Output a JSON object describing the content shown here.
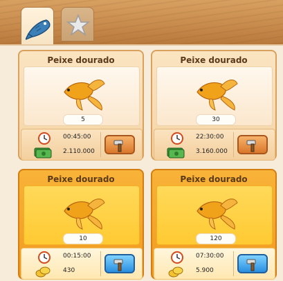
{
  "tabs": [
    {
      "name": "fish",
      "icon": "fish-icon",
      "active": true
    },
    {
      "name": "star",
      "icon": "star-icon",
      "active": false
    }
  ],
  "cards": [
    {
      "title": "Peixe dourado",
      "quantity": "5",
      "time": "00:45:00",
      "price": "2.110.000",
      "currency": "cash-icon",
      "style": "white",
      "button": "hammer-icon"
    },
    {
      "title": "Peixe dourado",
      "quantity": "30",
      "time": "22:30:00",
      "price": "3.160.000",
      "currency": "cash-icon",
      "style": "white",
      "button": "hammer-icon"
    },
    {
      "title": "Peixe dourado",
      "quantity": "10",
      "time": "00:15:00",
      "price": "430",
      "currency": "coins-icon",
      "style": "gold",
      "button": "hammer-icon"
    },
    {
      "title": "Peixe dourado",
      "quantity": "120",
      "time": "07:30:00",
      "price": "5.900",
      "currency": "coins-icon",
      "style": "gold",
      "button": "hammer-icon"
    }
  ],
  "colors": {
    "white_card": "#f5d4a6",
    "gold_card": "#f19a1f",
    "orange_button": "#d9772c",
    "blue_button": "#2a8fe0"
  }
}
